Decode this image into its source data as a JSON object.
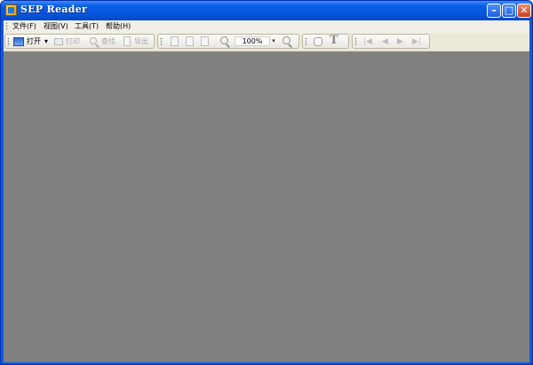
{
  "window": {
    "title": "SEP Reader",
    "buttons": {
      "minimize": "–",
      "maximize": "□",
      "close": "✕"
    }
  },
  "menu": {
    "items": [
      {
        "label": "文件(F)"
      },
      {
        "label": "视图(V)"
      },
      {
        "label": "工具(T)"
      },
      {
        "label": "帮助(H)"
      }
    ]
  },
  "toolbar": {
    "open_label": "打开",
    "open_dropdown": "▾",
    "print_label": "打印",
    "find_label": "查找",
    "export_label": "导出",
    "zoom_value": "100%",
    "zoom_dropdown": "▾",
    "text_tool_glyph": "T",
    "nav": {
      "first": "|◀",
      "prev": "◀",
      "next": "▶",
      "last": "▶|"
    }
  },
  "colors": {
    "titlebar": "#0a5be0",
    "client_bg": "#ece9d8",
    "content_bg": "#808080",
    "disabled_text": "#a8a8a8"
  },
  "icons": {
    "app": "sep-reader-app-icon",
    "open": "open-folder-icon",
    "print": "printer-icon",
    "find": "magnifier-icon",
    "export": "export-icon",
    "zoom_in": "zoom-in-icon",
    "zoom_out": "zoom-out-icon",
    "hand": "hand-tool-icon",
    "text": "text-select-icon"
  }
}
